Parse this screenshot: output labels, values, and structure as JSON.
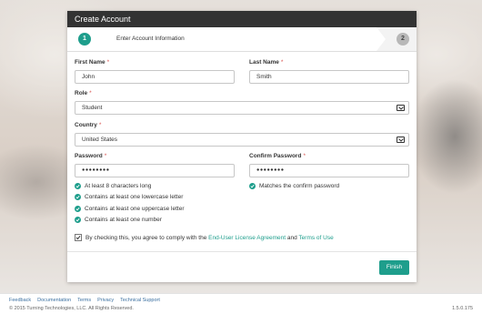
{
  "panel": {
    "title": "Create Account"
  },
  "steps": [
    {
      "number": "1",
      "label": "Enter Account Information"
    },
    {
      "number": "2"
    }
  ],
  "form": {
    "first_name": {
      "label": "First Name",
      "value": "John"
    },
    "last_name": {
      "label": "Last Name",
      "value": "Smith"
    },
    "role": {
      "label": "Role",
      "value": "Student"
    },
    "country": {
      "label": "Country",
      "value": "United States"
    },
    "password": {
      "label": "Password",
      "value": "●●●●●●●●"
    },
    "confirm_password": {
      "label": "Confirm Password",
      "value": "●●●●●●●●"
    },
    "required_marker": "*"
  },
  "password_rules": [
    "At least 8 characters long",
    "Contains at least one lowercase letter",
    "Contains at least one uppercase letter",
    "Contains at least one number"
  ],
  "confirm_rule": "Matches the confirm password",
  "agreement": {
    "prefix": "By checking this, you agree to comply with the",
    "eula_link": "End-User License Agreement",
    "and": "and",
    "terms_link": "Terms of Use"
  },
  "finish_label": "Finish",
  "footer": {
    "links": [
      "Feedback",
      "Documentation",
      "Terms",
      "Privacy",
      "Technical Support"
    ],
    "copyright": "© 2015 Turning Technologies, LLC. All Rights Reserved.",
    "version": "1.5.0.175"
  },
  "colors": {
    "accent": "#1e9e8c",
    "header": "#333333"
  }
}
